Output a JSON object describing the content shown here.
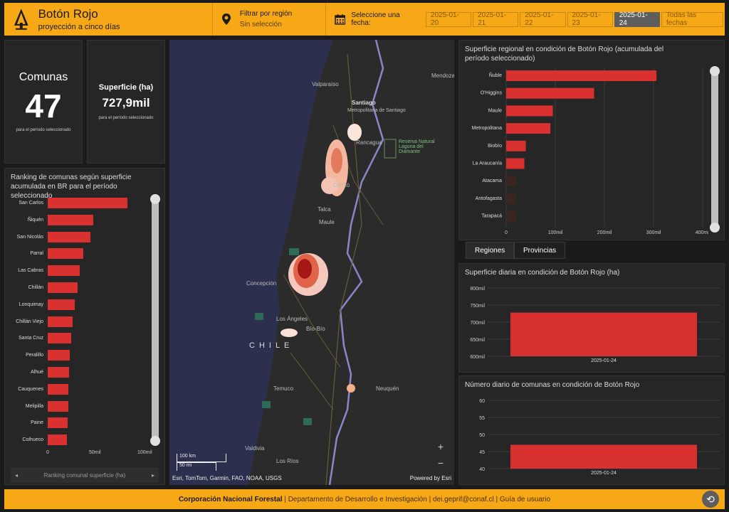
{
  "header": {
    "title": "Botón Rojo",
    "subtitle": "proyección a cinco días",
    "region_filter_label": "Filtrar por región",
    "region_filter_value": "Sin selección",
    "date_label": "Seleccione una fecha:",
    "dates": [
      "2025-01-20",
      "2025-01-21",
      "2025-01-22",
      "2025-01-23",
      "2025-01-24"
    ],
    "all_dates": "Todas las fechas",
    "selected_date": "2025-01-24"
  },
  "stats": {
    "comunas_title": "Comunas",
    "comunas_value": "47",
    "comunas_note": "para el período seleccionado",
    "superficie_title": "Superficie (ha)",
    "superficie_value": "727,9mil",
    "superficie_note": "para el período seleccionado"
  },
  "ranking": {
    "title": "Ranking de comunas según superficie acumulada en BR para el período seleccionado",
    "footer_label": "Ranking comunal superficie (ha)",
    "axis_ticks": [
      "0",
      "50mil",
      "100mil"
    ]
  },
  "map": {
    "labels": [
      "Valparaíso",
      "Santiago",
      "Metropolitana de Santiago",
      "Rancagua",
      "Curicó",
      "Talca",
      "Maule",
      "Concepción",
      "Los Ángeles",
      "Bío-Bío",
      "CHILE",
      "Temuco",
      "Neuquén",
      "Valdivia",
      "Los Ríos",
      "Mendoza",
      "Reserva Natural Laguna del Diamante"
    ],
    "scale_km": "100 km",
    "scale_mi": "50 mi",
    "attribution": "Esri, TomTom, Garmin, FAO, NOAA, USGS",
    "powered": "Powered by Esri",
    "zoom_in": "+",
    "zoom_out": "−"
  },
  "tabs": [
    "Regiones",
    "Provincias"
  ],
  "charts": {
    "regional_title": "Superficie regional en condición de Botón Rojo (acumulada del período seleccionado)",
    "daily_area_title": "Superficie diaria en condición de Botón Rojo (ha)",
    "daily_count_title": "Número diario de comunas en condición de Botón Rojo"
  },
  "footer": {
    "org": "Corporación Nacional Forestal",
    "dept": "Departamento de Desarrollo e Investigación",
    "email": "dei.geprif@conaf.cl",
    "guide": "Guía de usuario"
  },
  "colors": {
    "accent": "#f6a816",
    "bar": "#d8312f",
    "panel": "#262626"
  },
  "chart_data": [
    {
      "type": "bar",
      "title": "Ranking de comunas según superficie acumulada en BR para el período seleccionado",
      "categories": [
        "San Carlos",
        "Ñiquén",
        "San Nicolás",
        "Parral",
        "Las Cabras",
        "Chillán",
        "Lonquimay",
        "Chillán Viejo",
        "Santa Cruz",
        "Peralillo",
        "Alhué",
        "Cauquenes",
        "Melipilla",
        "Paine",
        "Coihueco"
      ],
      "values": [
        82000,
        47000,
        44000,
        37000,
        33000,
        31000,
        28000,
        26000,
        24000,
        23000,
        22000,
        21500,
        21000,
        20500,
        20000
      ],
      "xlim": [
        0,
        100000
      ],
      "orientation": "horizontal"
    },
    {
      "type": "bar",
      "title": "Superficie regional en condición de Botón Rojo (acumulada del período seleccionado)",
      "categories": [
        "Ñuble",
        "O'Higgins",
        "Maule",
        "Metropolitana",
        "Biobío",
        "La Araucanía",
        "Atacama",
        "Antofagasta",
        "Tarapacá"
      ],
      "values": [
        306000,
        179000,
        95000,
        90000,
        40000,
        37000,
        0,
        0,
        0
      ],
      "xlim": [
        0,
        400000
      ],
      "axis_ticks": [
        "0",
        "100mil",
        "200mil",
        "300mil",
        "400mil"
      ],
      "orientation": "horizontal"
    },
    {
      "type": "bar",
      "title": "Superficie diaria en condición de Botón Rojo (ha)",
      "categories": [
        "2025-01-24"
      ],
      "values": [
        727900
      ],
      "ylim": [
        600000,
        800000
      ],
      "axis_ticks": [
        "600mil",
        "650mil",
        "700mil",
        "750mil",
        "800mil"
      ]
    },
    {
      "type": "bar",
      "title": "Número diario de comunas en condición de Botón Rojo",
      "categories": [
        "2025-01-24"
      ],
      "values": [
        47
      ],
      "ylim": [
        40,
        60
      ],
      "axis_ticks": [
        "40",
        "45",
        "50",
        "55",
        "60"
      ]
    }
  ]
}
